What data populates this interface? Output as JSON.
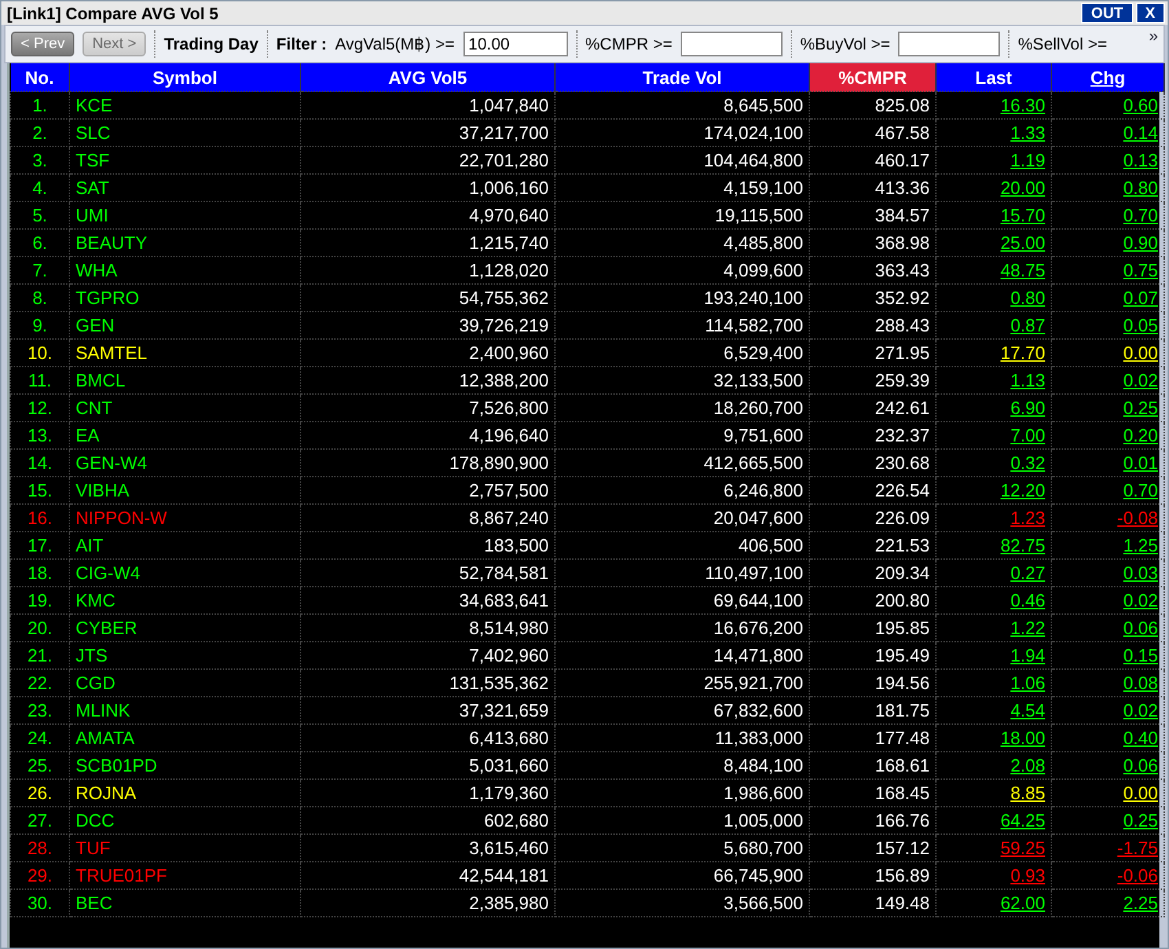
{
  "window": {
    "title": "[Link1] Compare AVG Vol 5",
    "buttons": [
      "OUT",
      "X"
    ]
  },
  "toolbar": {
    "prev": {
      "label": "< Prev",
      "disabled": false
    },
    "next": {
      "label": "Next >",
      "disabled": true
    },
    "mode": "Trading Day",
    "filter_label": "Filter :",
    "filters": [
      {
        "label": "AvgVal5(M฿) >=",
        "field": true,
        "value": "10.00"
      },
      {
        "label": "%CMPR >=",
        "field": true
      },
      {
        "label": "%BuyVol >=",
        "field": true
      },
      {
        "label": "%SellVol >=",
        "field": false
      }
    ],
    "more": "»"
  },
  "table": {
    "columns": [
      {
        "label": "No.",
        "selected": false,
        "underlined": false
      },
      {
        "label": "Symbol",
        "selected": false,
        "underlined": false
      },
      {
        "label": "AVG Vol5",
        "selected": false,
        "underlined": false
      },
      {
        "label": "Trade Vol",
        "selected": false,
        "underlined": false
      },
      {
        "label": "%CMPR",
        "selected": true,
        "underlined": false
      },
      {
        "label": "Last",
        "selected": false,
        "underlined": false
      },
      {
        "label": "Chg",
        "selected": false,
        "underlined": true
      }
    ],
    "rows": [
      {
        "no": "1.",
        "symbol": "KCE",
        "avg_vol5": "1,047,840",
        "trade_vol": "8,645,500",
        "cmpr": "825.08",
        "last": "16.30",
        "chg": "0.60",
        "color": "#00ff00"
      },
      {
        "no": "2.",
        "symbol": "SLC",
        "avg_vol5": "37,217,700",
        "trade_vol": "174,024,100",
        "cmpr": "467.58",
        "last": "1.33",
        "chg": "0.14",
        "color": "#00ff00"
      },
      {
        "no": "3.",
        "symbol": "TSF",
        "avg_vol5": "22,701,280",
        "trade_vol": "104,464,800",
        "cmpr": "460.17",
        "last": "1.19",
        "chg": "0.13",
        "color": "#00ff00"
      },
      {
        "no": "4.",
        "symbol": "SAT",
        "avg_vol5": "1,006,160",
        "trade_vol": "4,159,100",
        "cmpr": "413.36",
        "last": "20.00",
        "chg": "0.80",
        "color": "#00ff00"
      },
      {
        "no": "5.",
        "symbol": "UMI",
        "avg_vol5": "4,970,640",
        "trade_vol": "19,115,500",
        "cmpr": "384.57",
        "last": "15.70",
        "chg": "0.70",
        "color": "#00ff00"
      },
      {
        "no": "6.",
        "symbol": "BEAUTY",
        "avg_vol5": "1,215,740",
        "trade_vol": "4,485,800",
        "cmpr": "368.98",
        "last": "25.00",
        "chg": "0.90",
        "color": "#00ff00"
      },
      {
        "no": "7.",
        "symbol": "WHA",
        "avg_vol5": "1,128,020",
        "trade_vol": "4,099,600",
        "cmpr": "363.43",
        "last": "48.75",
        "chg": "0.75",
        "color": "#00ff00"
      },
      {
        "no": "8.",
        "symbol": "TGPRO",
        "avg_vol5": "54,755,362",
        "trade_vol": "193,240,100",
        "cmpr": "352.92",
        "last": "0.80",
        "chg": "0.07",
        "color": "#00ff00"
      },
      {
        "no": "9.",
        "symbol": "GEN",
        "avg_vol5": "39,726,219",
        "trade_vol": "114,582,700",
        "cmpr": "288.43",
        "last": "0.87",
        "chg": "0.05",
        "color": "#00ff00"
      },
      {
        "no": "10.",
        "symbol": "SAMTEL",
        "avg_vol5": "2,400,960",
        "trade_vol": "6,529,400",
        "cmpr": "271.95",
        "last": "17.70",
        "chg": "0.00",
        "color": "#ffff00"
      },
      {
        "no": "11.",
        "symbol": "BMCL",
        "avg_vol5": "12,388,200",
        "trade_vol": "32,133,500",
        "cmpr": "259.39",
        "last": "1.13",
        "chg": "0.02",
        "color": "#00ff00"
      },
      {
        "no": "12.",
        "symbol": "CNT",
        "avg_vol5": "7,526,800",
        "trade_vol": "18,260,700",
        "cmpr": "242.61",
        "last": "6.90",
        "chg": "0.25",
        "color": "#00ff00"
      },
      {
        "no": "13.",
        "symbol": "EA",
        "avg_vol5": "4,196,640",
        "trade_vol": "9,751,600",
        "cmpr": "232.37",
        "last": "7.00",
        "chg": "0.20",
        "color": "#00ff00"
      },
      {
        "no": "14.",
        "symbol": "GEN-W4",
        "avg_vol5": "178,890,900",
        "trade_vol": "412,665,500",
        "cmpr": "230.68",
        "last": "0.32",
        "chg": "0.01",
        "color": "#00ff00"
      },
      {
        "no": "15.",
        "symbol": "VIBHA",
        "avg_vol5": "2,757,500",
        "trade_vol": "6,246,800",
        "cmpr": "226.54",
        "last": "12.20",
        "chg": "0.70",
        "color": "#00ff00"
      },
      {
        "no": "16.",
        "symbol": "NIPPON-W",
        "avg_vol5": "8,867,240",
        "trade_vol": "20,047,600",
        "cmpr": "226.09",
        "last": "1.23",
        "chg": "-0.08",
        "color": "#ff0000"
      },
      {
        "no": "17.",
        "symbol": "AIT",
        "avg_vol5": "183,500",
        "trade_vol": "406,500",
        "cmpr": "221.53",
        "last": "82.75",
        "chg": "1.25",
        "color": "#00ff00"
      },
      {
        "no": "18.",
        "symbol": "CIG-W4",
        "avg_vol5": "52,784,581",
        "trade_vol": "110,497,100",
        "cmpr": "209.34",
        "last": "0.27",
        "chg": "0.03",
        "color": "#00ff00"
      },
      {
        "no": "19.",
        "symbol": "KMC",
        "avg_vol5": "34,683,641",
        "trade_vol": "69,644,100",
        "cmpr": "200.80",
        "last": "0.46",
        "chg": "0.02",
        "color": "#00ff00"
      },
      {
        "no": "20.",
        "symbol": "CYBER",
        "avg_vol5": "8,514,980",
        "trade_vol": "16,676,200",
        "cmpr": "195.85",
        "last": "1.22",
        "chg": "0.06",
        "color": "#00ff00"
      },
      {
        "no": "21.",
        "symbol": "JTS",
        "avg_vol5": "7,402,960",
        "trade_vol": "14,471,800",
        "cmpr": "195.49",
        "last": "1.94",
        "chg": "0.15",
        "color": "#00ff00"
      },
      {
        "no": "22.",
        "symbol": "CGD",
        "avg_vol5": "131,535,362",
        "trade_vol": "255,921,700",
        "cmpr": "194.56",
        "last": "1.06",
        "chg": "0.08",
        "color": "#00ff00"
      },
      {
        "no": "23.",
        "symbol": "MLINK",
        "avg_vol5": "37,321,659",
        "trade_vol": "67,832,600",
        "cmpr": "181.75",
        "last": "4.54",
        "chg": "0.02",
        "color": "#00ff00"
      },
      {
        "no": "24.",
        "symbol": "AMATA",
        "avg_vol5": "6,413,680",
        "trade_vol": "11,383,000",
        "cmpr": "177.48",
        "last": "18.00",
        "chg": "0.40",
        "color": "#00ff00"
      },
      {
        "no": "25.",
        "symbol": "SCB01PD",
        "avg_vol5": "5,031,660",
        "trade_vol": "8,484,100",
        "cmpr": "168.61",
        "last": "2.08",
        "chg": "0.06",
        "color": "#00ff00"
      },
      {
        "no": "26.",
        "symbol": "ROJNA",
        "avg_vol5": "1,179,360",
        "trade_vol": "1,986,600",
        "cmpr": "168.45",
        "last": "8.85",
        "chg": "0.00",
        "color": "#ffff00"
      },
      {
        "no": "27.",
        "symbol": "DCC",
        "avg_vol5": "602,680",
        "trade_vol": "1,005,000",
        "cmpr": "166.76",
        "last": "64.25",
        "chg": "0.25",
        "color": "#00ff00"
      },
      {
        "no": "28.",
        "symbol": "TUF",
        "avg_vol5": "3,615,460",
        "trade_vol": "5,680,700",
        "cmpr": "157.12",
        "last": "59.25",
        "chg": "-1.75",
        "color": "#ff0000"
      },
      {
        "no": "29.",
        "symbol": "TRUE01PF",
        "avg_vol5": "42,544,181",
        "trade_vol": "66,745,900",
        "cmpr": "156.89",
        "last": "0.93",
        "chg": "-0.06",
        "color": "#ff0000"
      },
      {
        "no": "30.",
        "symbol": "BEC",
        "avg_vol5": "2,385,980",
        "trade_vol": "3,566,500",
        "cmpr": "149.48",
        "last": "62.00",
        "chg": "2.25",
        "color": "#00ff00"
      }
    ]
  }
}
